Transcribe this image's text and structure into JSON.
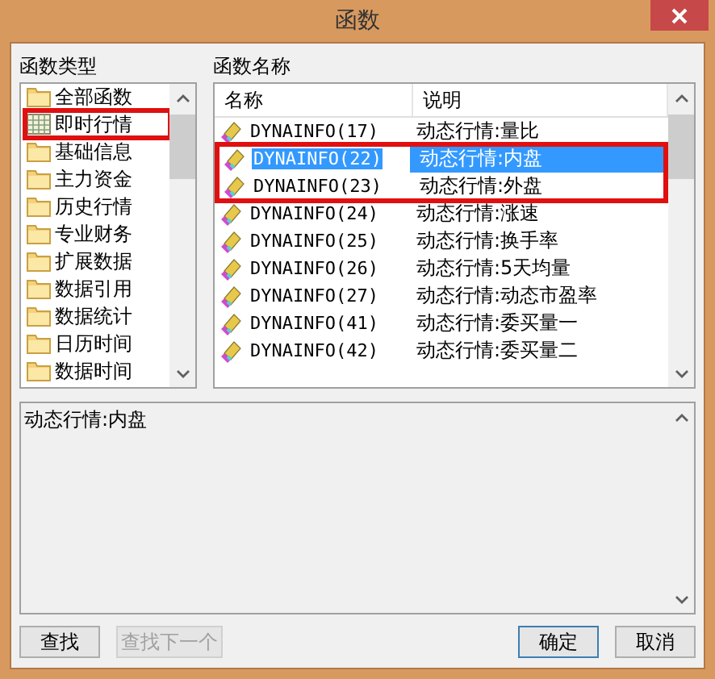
{
  "window": {
    "title": "函数"
  },
  "categories": {
    "label": "函数类型",
    "items": [
      {
        "label": "全部函数",
        "kind": "folder",
        "outlined": false
      },
      {
        "label": "即时行情",
        "kind": "grid",
        "outlined": true
      },
      {
        "label": "基础信息",
        "kind": "folder",
        "outlined": false
      },
      {
        "label": "主力资金",
        "kind": "folder",
        "outlined": false
      },
      {
        "label": "历史行情",
        "kind": "folder",
        "outlined": false
      },
      {
        "label": "专业财务",
        "kind": "folder",
        "outlined": false
      },
      {
        "label": "扩展数据",
        "kind": "folder",
        "outlined": false
      },
      {
        "label": "数据引用",
        "kind": "folder",
        "outlined": false
      },
      {
        "label": "数据统计",
        "kind": "folder",
        "outlined": false
      },
      {
        "label": "日历时间",
        "kind": "folder",
        "outlined": false
      },
      {
        "label": "数据时间",
        "kind": "folder",
        "outlined": false
      }
    ]
  },
  "functions": {
    "label": "函数名称",
    "columns": [
      "名称",
      "说明"
    ],
    "rows": [
      {
        "name": "DYNAINFO(17)",
        "desc": "动态行情:量比",
        "selected": false,
        "outlined": false
      },
      {
        "name": "DYNAINFO(22)",
        "desc": "动态行情:内盘",
        "selected": true,
        "outlined": true
      },
      {
        "name": "DYNAINFO(23)",
        "desc": "动态行情:外盘",
        "selected": false,
        "outlined": true
      },
      {
        "name": "DYNAINFO(24)",
        "desc": "动态行情:涨速",
        "selected": false,
        "outlined": false
      },
      {
        "name": "DYNAINFO(25)",
        "desc": "动态行情:换手率",
        "selected": false,
        "outlined": false
      },
      {
        "name": "DYNAINFO(26)",
        "desc": "动态行情:5天均量",
        "selected": false,
        "outlined": false
      },
      {
        "name": "DYNAINFO(27)",
        "desc": "动态行情:动态市盈率",
        "selected": false,
        "outlined": false
      },
      {
        "name": "DYNAINFO(41)",
        "desc": "动态行情:委买量一",
        "selected": false,
        "outlined": false
      },
      {
        "name": "DYNAINFO(42)",
        "desc": "动态行情:委买量二",
        "selected": false,
        "outlined": false
      }
    ]
  },
  "description": "动态行情:内盘",
  "buttons": [
    {
      "label": "查找",
      "disabled": false,
      "default": false
    },
    {
      "label": "查找下一个",
      "disabled": true,
      "default": false
    },
    {
      "label": "确定",
      "disabled": false,
      "default": true
    },
    {
      "label": "取消",
      "disabled": false,
      "default": false
    }
  ]
}
